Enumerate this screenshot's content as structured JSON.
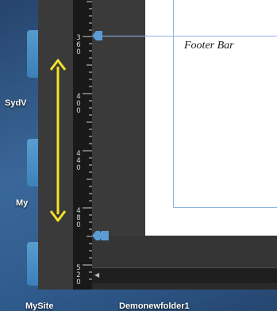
{
  "desktop": {
    "icons": [
      {
        "label": "SydV",
        "name": "desktop-folder-sydv"
      },
      {
        "label": "My",
        "name": "desktop-folder-my"
      },
      {
        "label": "MySite",
        "name": "desktop-folder-mysite"
      },
      {
        "label": "Demonewfolder1",
        "name": "desktop-folder-demonewfolder1"
      }
    ]
  },
  "ruler": {
    "numbers": [
      "360",
      "400",
      "440",
      "480",
      "520"
    ]
  },
  "canvas": {
    "label": "Footer Bar"
  },
  "colors": {
    "guide": "#8fb4e0",
    "marker": "#5b9bd5",
    "arrow": "#f5e22a",
    "panel": "#3a3a3a",
    "ruler": "#191919"
  },
  "icons": {
    "resize_arrow": "double-headed-vertical-arrow",
    "guide_markers": "triangle-marker",
    "scroll_left": "triangle-left"
  }
}
